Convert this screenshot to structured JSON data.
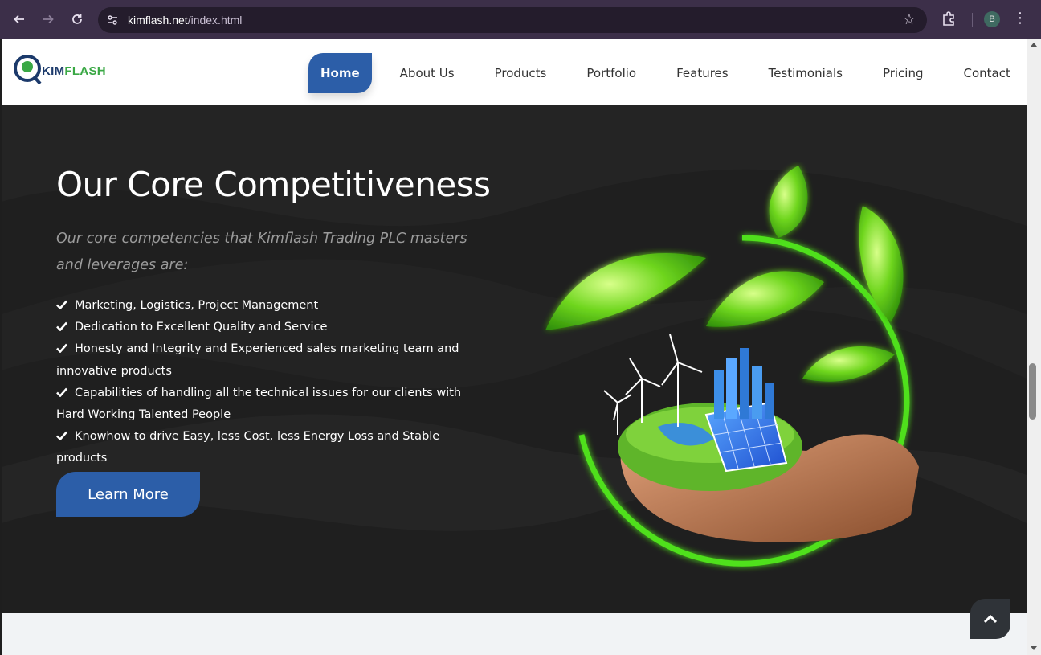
{
  "browser": {
    "url_host": "kimflash.net",
    "url_path": "/index.html",
    "profile_initial": "B"
  },
  "site": {
    "logo": {
      "part1": "KIM",
      "part2": "FLASH"
    },
    "nav": [
      {
        "label": "Home",
        "active": true
      },
      {
        "label": "About Us"
      },
      {
        "label": "Products"
      },
      {
        "label": "Portfolio"
      },
      {
        "label": "Features"
      },
      {
        "label": "Testimonials"
      },
      {
        "label": "Pricing"
      },
      {
        "label": "Contact"
      }
    ],
    "hero": {
      "title": "Our Core Competitiveness",
      "subtitle": "Our core competencies that Kimflash Trading PLC masters and leverages are:",
      "bullets": [
        "Marketing, Logistics, Project Management",
        "Dedication to Excellent Quality and Service",
        "Honesty and Integrity and Experienced sales marketing team and innovative products",
        "Capabilities of handling all the technical issues for our clients with Hard Working Talented People",
        "Knowhow to drive Easy, less Cost, less Energy Loss and Stable products"
      ],
      "button_label": "Learn More"
    }
  },
  "colors": {
    "brand_blue": "#2c5ea8",
    "brand_green": "#3aa845",
    "hero_bg": "#1f1f1f",
    "chrome_bg": "#3c2f49"
  },
  "icons": {
    "back": "arrow-left-icon",
    "forward": "arrow-right-icon",
    "reload": "reload-icon",
    "site_info": "tune-icon",
    "bookmark": "star-icon",
    "extensions": "puzzle-icon",
    "menu": "kebab-icon",
    "bullet": "check-icon",
    "scroll_top": "chevron-up-icon"
  }
}
